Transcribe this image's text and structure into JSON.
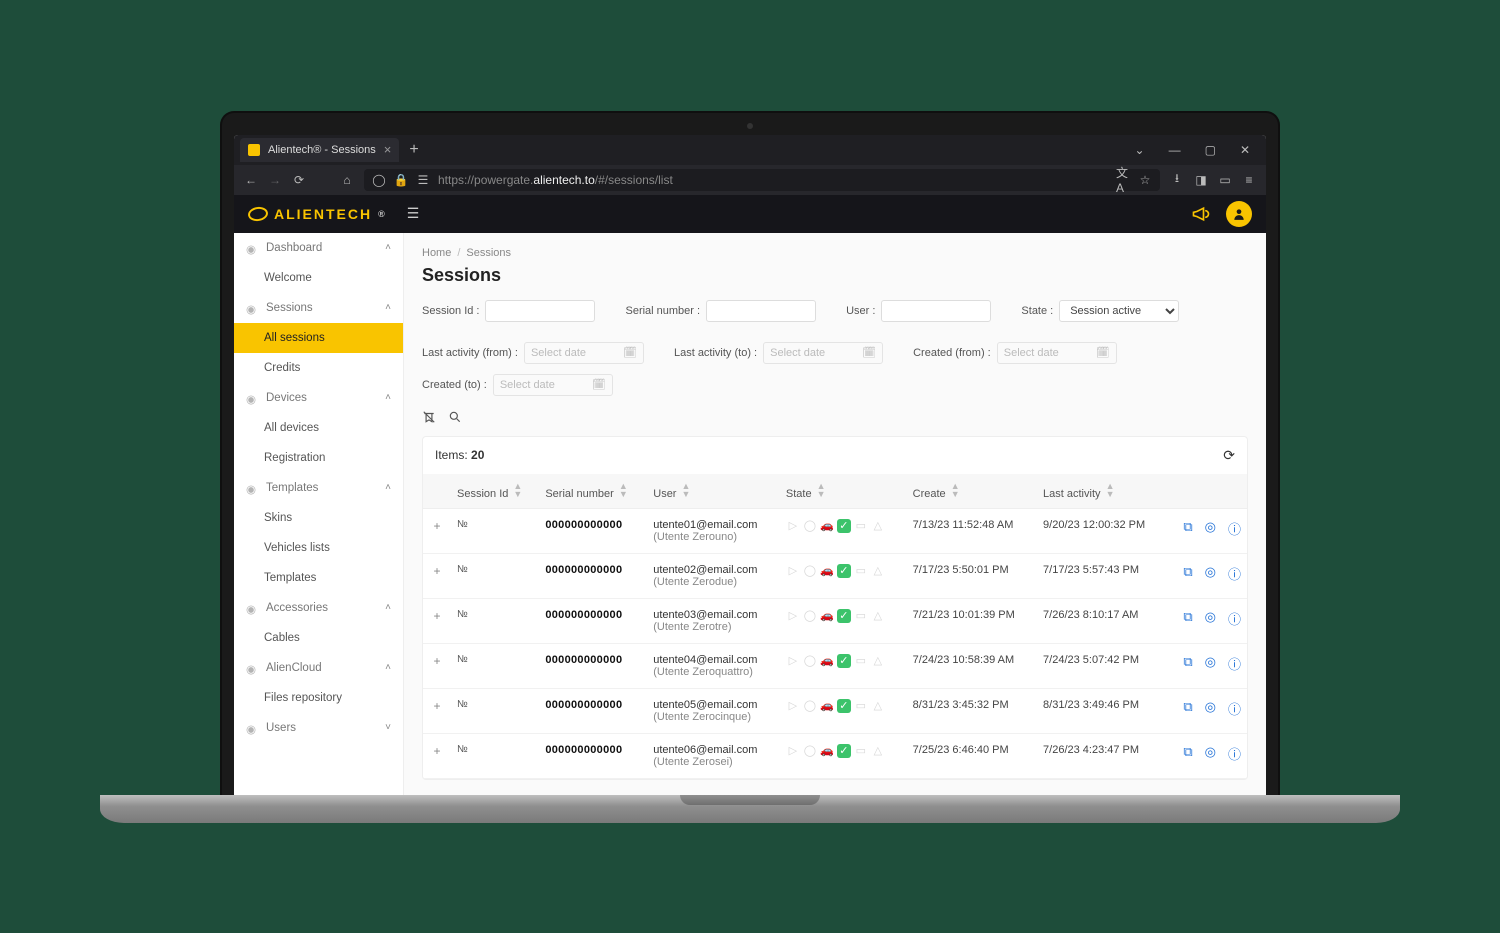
{
  "browser": {
    "tab_title": "Alientech® - Sessions",
    "url_prefix": "https://powergate.",
    "url_host": "alientech.to",
    "url_path": "/#/sessions/list"
  },
  "brand": {
    "logo_text": "ALIENTECH",
    "trademark": "®",
    "accent": "#f9c400"
  },
  "sidebar": {
    "groups": [
      {
        "label": "Dashboard",
        "expanded": true,
        "items": [
          {
            "label": "Welcome",
            "active": false
          }
        ]
      },
      {
        "label": "Sessions",
        "expanded": true,
        "items": [
          {
            "label": "All sessions",
            "active": true
          },
          {
            "label": "Credits",
            "active": false
          }
        ]
      },
      {
        "label": "Devices",
        "expanded": true,
        "items": [
          {
            "label": "All devices",
            "active": false
          },
          {
            "label": "Registration",
            "active": false
          }
        ]
      },
      {
        "label": "Templates",
        "expanded": true,
        "items": [
          {
            "label": "Skins",
            "active": false
          },
          {
            "label": "Vehicles lists",
            "active": false
          },
          {
            "label": "Templates",
            "active": false
          }
        ]
      },
      {
        "label": "Accessories",
        "expanded": true,
        "items": [
          {
            "label": "Cables",
            "active": false
          }
        ]
      },
      {
        "label": "AlienCloud",
        "expanded": true,
        "items": [
          {
            "label": "Files repository",
            "active": false
          }
        ]
      },
      {
        "label": "Users",
        "expanded": false,
        "items": []
      }
    ]
  },
  "breadcrumb": {
    "home": "Home",
    "current": "Sessions"
  },
  "page_title": "Sessions",
  "filters": {
    "session_id": {
      "label": "Session Id :",
      "value": ""
    },
    "serial": {
      "label": "Serial number :",
      "value": ""
    },
    "user": {
      "label": "User :",
      "value": ""
    },
    "state": {
      "label": "State :",
      "value": "Session active"
    },
    "activity_from": {
      "label": "Last activity (from) :",
      "placeholder": "Select date"
    },
    "activity_to": {
      "label": "Last activity (to) :",
      "placeholder": "Select date"
    },
    "created_from": {
      "label": "Created (from) :",
      "placeholder": "Select date"
    },
    "created_to": {
      "label": "Created (to) :",
      "placeholder": "Select date"
    }
  },
  "table": {
    "items_label": "Items:",
    "items_count": "20",
    "columns": [
      "",
      "Session Id",
      "Serial number",
      "User",
      "State",
      "Create",
      "Last activity",
      ""
    ],
    "session_id_prefix": "№",
    "rows": [
      {
        "serial": "000000000000",
        "email": "utente01@email.com",
        "user": "(Utente Zerouno)",
        "create": "7/13/23 11:52:48 AM",
        "activity": "9/20/23 12:00:32 PM"
      },
      {
        "serial": "000000000000",
        "email": "utente02@email.com",
        "user": "(Utente Zerodue)",
        "create": "7/17/23 5:50:01 PM",
        "activity": "7/17/23 5:57:43 PM"
      },
      {
        "serial": "000000000000",
        "email": "utente03@email.com",
        "user": "(Utente Zerotre)",
        "create": "7/21/23 10:01:39 PM",
        "activity": "7/26/23 8:10:17 AM"
      },
      {
        "serial": "000000000000",
        "email": "utente04@email.com",
        "user": "(Utente Zeroquattro)",
        "create": "7/24/23 10:58:39 AM",
        "activity": "7/24/23 5:07:42 PM"
      },
      {
        "serial": "000000000000",
        "email": "utente05@email.com",
        "user": "(Utente Zerocinque)",
        "create": "8/31/23 3:45:32 PM",
        "activity": "8/31/23 3:49:46 PM"
      },
      {
        "serial": "000000000000",
        "email": "utente06@email.com",
        "user": "(Utente Zerosei)",
        "create": "7/25/23 6:46:40 PM",
        "activity": "7/26/23 4:23:47 PM"
      }
    ]
  }
}
